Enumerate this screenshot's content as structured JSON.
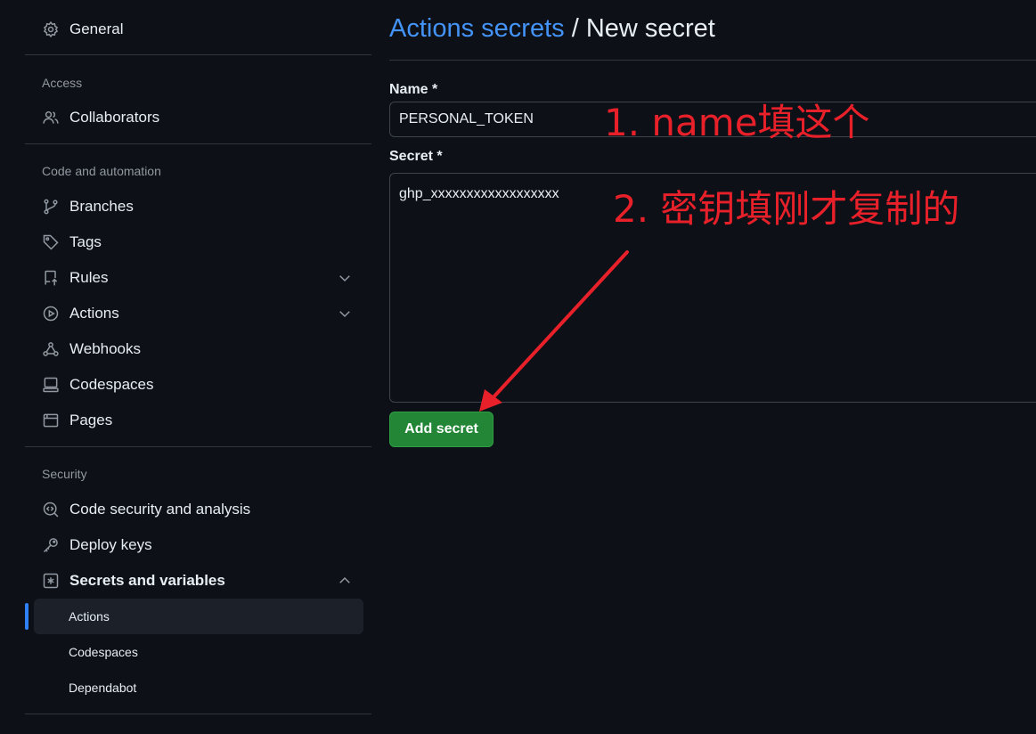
{
  "sidebar": {
    "general": {
      "label": "General",
      "icon": "gear-icon"
    },
    "sections": {
      "access": "Access",
      "code_automation": "Code and automation",
      "security": "Security"
    },
    "access_items": [
      {
        "label": "Collaborators",
        "icon": "people-icon"
      }
    ],
    "code_items": [
      {
        "label": "Branches",
        "icon": "branch-icon"
      },
      {
        "label": "Tags",
        "icon": "tag-icon"
      },
      {
        "label": "Rules",
        "icon": "rules-icon",
        "expandable": true
      },
      {
        "label": "Actions",
        "icon": "play-icon",
        "expandable": true
      },
      {
        "label": "Webhooks",
        "icon": "webhook-icon"
      },
      {
        "label": "Codespaces",
        "icon": "codespaces-icon"
      },
      {
        "label": "Pages",
        "icon": "browser-icon"
      }
    ],
    "security_items": [
      {
        "label": "Code security and analysis",
        "icon": "codescan-icon"
      },
      {
        "label": "Deploy keys",
        "icon": "key-icon"
      },
      {
        "label": "Secrets and variables",
        "icon": "asterisk-icon",
        "expanded": true
      }
    ],
    "sub_items": [
      {
        "label": "Actions",
        "active": true
      },
      {
        "label": "Codespaces",
        "active": false
      },
      {
        "label": "Dependabot",
        "active": false
      }
    ]
  },
  "main": {
    "breadcrumb_link": "Actions secrets",
    "breadcrumb_sep": " / ",
    "breadcrumb_current": "New secret",
    "name_label": "Name *",
    "name_value": "PERSONAL_TOKEN",
    "secret_label": "Secret *",
    "secret_value": "ghp_xxxxxxxxxxxxxxxxxx",
    "submit_label": "Add secret"
  },
  "annotations": {
    "note1": "1. name填这个",
    "note2": "2. 密钥填刚才复制的"
  },
  "colors": {
    "background": "#0d1117",
    "link": "#4493f8",
    "primary_button": "#238636",
    "annotation": "#e8202a",
    "active_indicator": "#2f81f7"
  }
}
